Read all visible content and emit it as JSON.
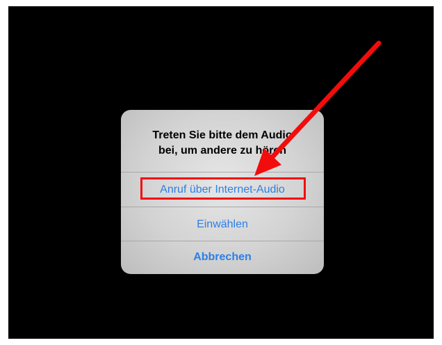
{
  "dialog": {
    "title": "Treten Sie bitte dem Audio\nbei, um andere zu hören",
    "actions": [
      {
        "label": "Anruf über Internet-Audio"
      },
      {
        "label": "Einwählen"
      },
      {
        "label": "Abbrechen"
      }
    ],
    "accent_color": "#2b7fe8"
  },
  "annotation": {
    "color": "#f20c0c",
    "type": "arrow-and-box"
  }
}
